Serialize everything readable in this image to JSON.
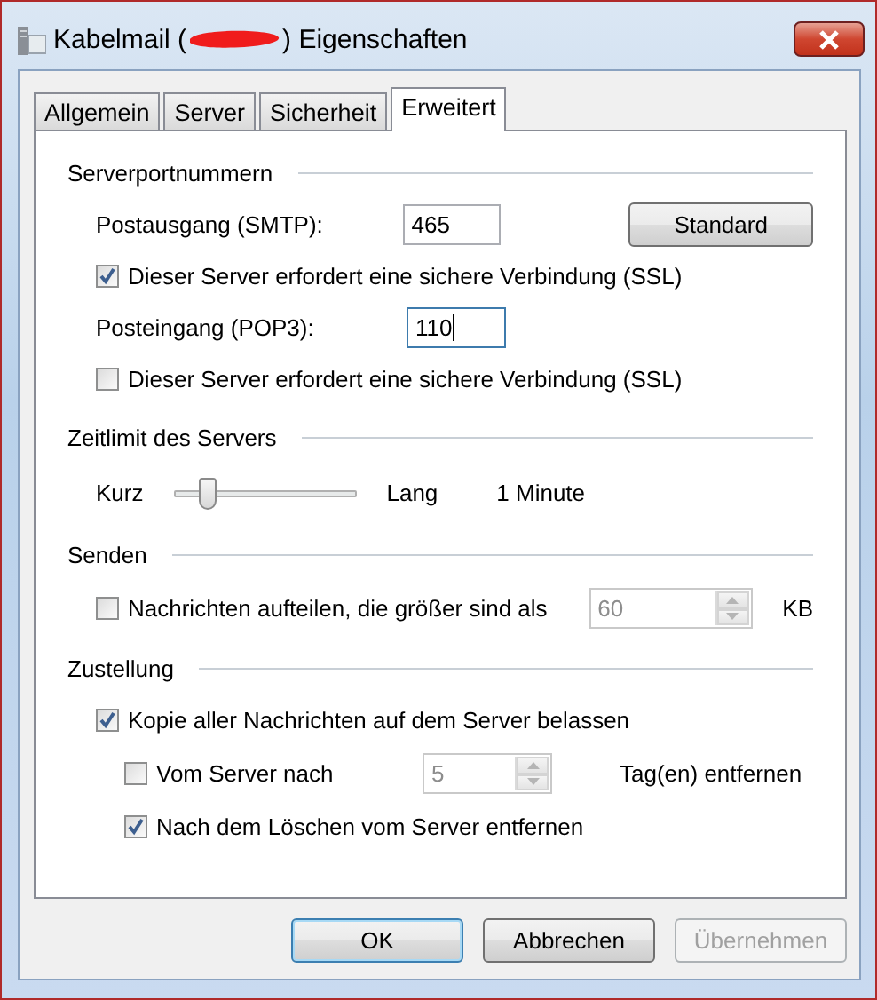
{
  "window": {
    "title_start": "Kabelmail (",
    "title_end": ") Eigenschaften"
  },
  "tabs": [
    {
      "label": "Allgemein",
      "selected": false
    },
    {
      "label": "Server",
      "selected": false
    },
    {
      "label": "Sicherheit",
      "selected": false
    },
    {
      "label": "Erweitert",
      "selected": true
    }
  ],
  "sections": [
    {
      "title": "Serverportnummern",
      "rows": [
        {
          "kind": "port",
          "label": "Postausgang (SMTP):",
          "value": "465",
          "focused": false,
          "button": "Standard"
        },
        {
          "kind": "checkbox",
          "label": "Dieser Server erfordert eine sichere Verbindung (SSL)",
          "checked": true
        },
        {
          "kind": "port",
          "label": "Posteingang (POP3):",
          "value": "110",
          "focused": true
        },
        {
          "kind": "checkbox",
          "label": "Dieser Server erfordert eine sichere Verbindung (SSL)",
          "checked": false
        }
      ]
    },
    {
      "title": "Zeitlimit des Servers",
      "rows": [
        {
          "kind": "slider",
          "min_label": "Kurz",
          "max_label": "Lang",
          "level": 0.15,
          "reading": "1 Minute"
        }
      ]
    },
    {
      "title": "Senden",
      "rows": [
        {
          "kind": "checkspin",
          "label": "Nachrichten aufteilen, die größer sind als",
          "checked": false,
          "value": "60",
          "disabled": true,
          "unit": "KB"
        }
      ]
    },
    {
      "title": "Zustellung",
      "rows": [
        {
          "kind": "checkbox",
          "label": "Kopie aller Nachrichten auf dem Server belassen",
          "checked": true,
          "children": [
            {
              "kind": "checkspin",
              "label": "Vom Server nach",
              "checked": false,
              "value": "5",
              "disabled": true,
              "unit": "Tag(en) entfernen"
            },
            {
              "kind": "checkbox",
              "label": "Nach dem Löschen vom Server entfernen",
              "checked": true
            }
          ]
        }
      ]
    }
  ],
  "buttons": [
    {
      "label": "OK",
      "default": true,
      "disabled": false
    },
    {
      "label": "Abbrechen",
      "default": false,
      "disabled": false
    },
    {
      "label": "Übernehmen",
      "default": false,
      "disabled": true
    }
  ]
}
